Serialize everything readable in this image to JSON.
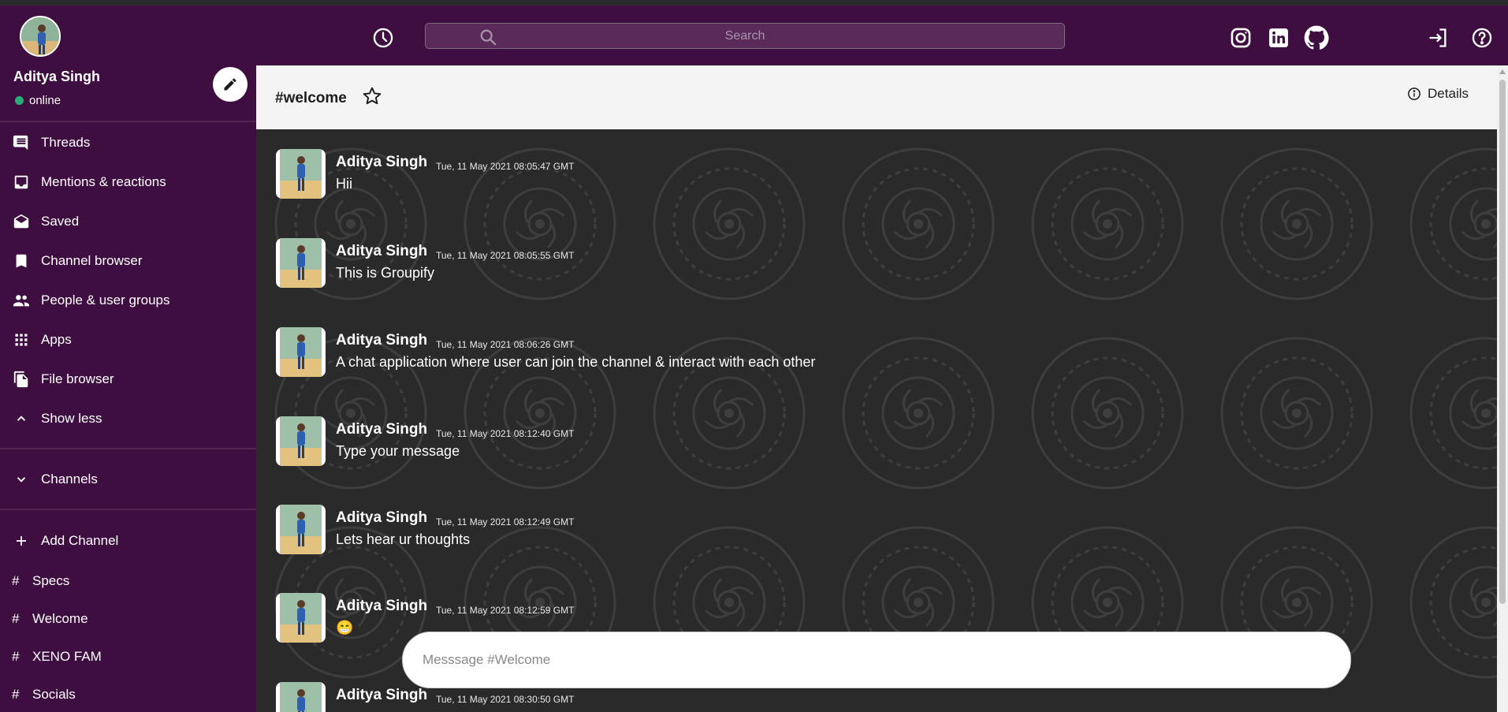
{
  "topbar": {
    "search_placeholder": "Search"
  },
  "user": {
    "name": "Aditya Singh",
    "status": "online"
  },
  "sidebar": {
    "nav": [
      {
        "label": "Threads",
        "icon": "threads-icon"
      },
      {
        "label": "Mentions & reactions",
        "icon": "inbox-icon"
      },
      {
        "label": "Saved",
        "icon": "drafts-icon"
      },
      {
        "label": "Channel browser",
        "icon": "bookmark-icon"
      },
      {
        "label": "People & user groups",
        "icon": "people-icon"
      },
      {
        "label": "Apps",
        "icon": "apps-grid-icon"
      },
      {
        "label": "File browser",
        "icon": "file-copy-icon"
      },
      {
        "label": "Show less",
        "icon": "chevron-up-icon"
      }
    ],
    "channels_label": "Channels",
    "add_channel_label": "Add Channel",
    "channels": [
      {
        "hash": "#",
        "name": "Specs"
      },
      {
        "hash": "#",
        "name": "Welcome"
      },
      {
        "hash": "#",
        "name": "XENO FAM"
      },
      {
        "hash": "#",
        "name": "Socials"
      }
    ]
  },
  "header": {
    "channel_title": "#welcome",
    "details_label": "Details"
  },
  "messages": [
    {
      "name": "Aditya Singh",
      "time": "Tue, 11 May 2021 08:05:47 GMT",
      "text": "Hii"
    },
    {
      "name": "Aditya Singh",
      "time": "Tue, 11 May 2021 08:05:55 GMT",
      "text": "This is Groupify"
    },
    {
      "name": "Aditya Singh",
      "time": "Tue, 11 May 2021 08:06:26 GMT",
      "text": "A chat application where user can join the channel & interact with each other"
    },
    {
      "name": "Aditya Singh",
      "time": "Tue, 11 May 2021 08:12:40 GMT",
      "text": "Type your message"
    },
    {
      "name": "Aditya Singh",
      "time": "Tue, 11 May 2021 08:12:49 GMT",
      "text": "Lets hear ur thoughts"
    },
    {
      "name": "Aditya Singh",
      "time": "Tue, 11 May 2021 08:12:59 GMT",
      "text": "😁"
    },
    {
      "name": "Aditya Singh",
      "time": "Tue, 11 May 2021 08:30:50 GMT",
      "text": ""
    }
  ],
  "composer": {
    "placeholder": "Messsage #Welcome"
  },
  "colors": {
    "sidebar": "#3f0e40",
    "online": "#2bac76",
    "chat_bg": "#2a2a2a",
    "header_bg": "#f4f4f4"
  }
}
